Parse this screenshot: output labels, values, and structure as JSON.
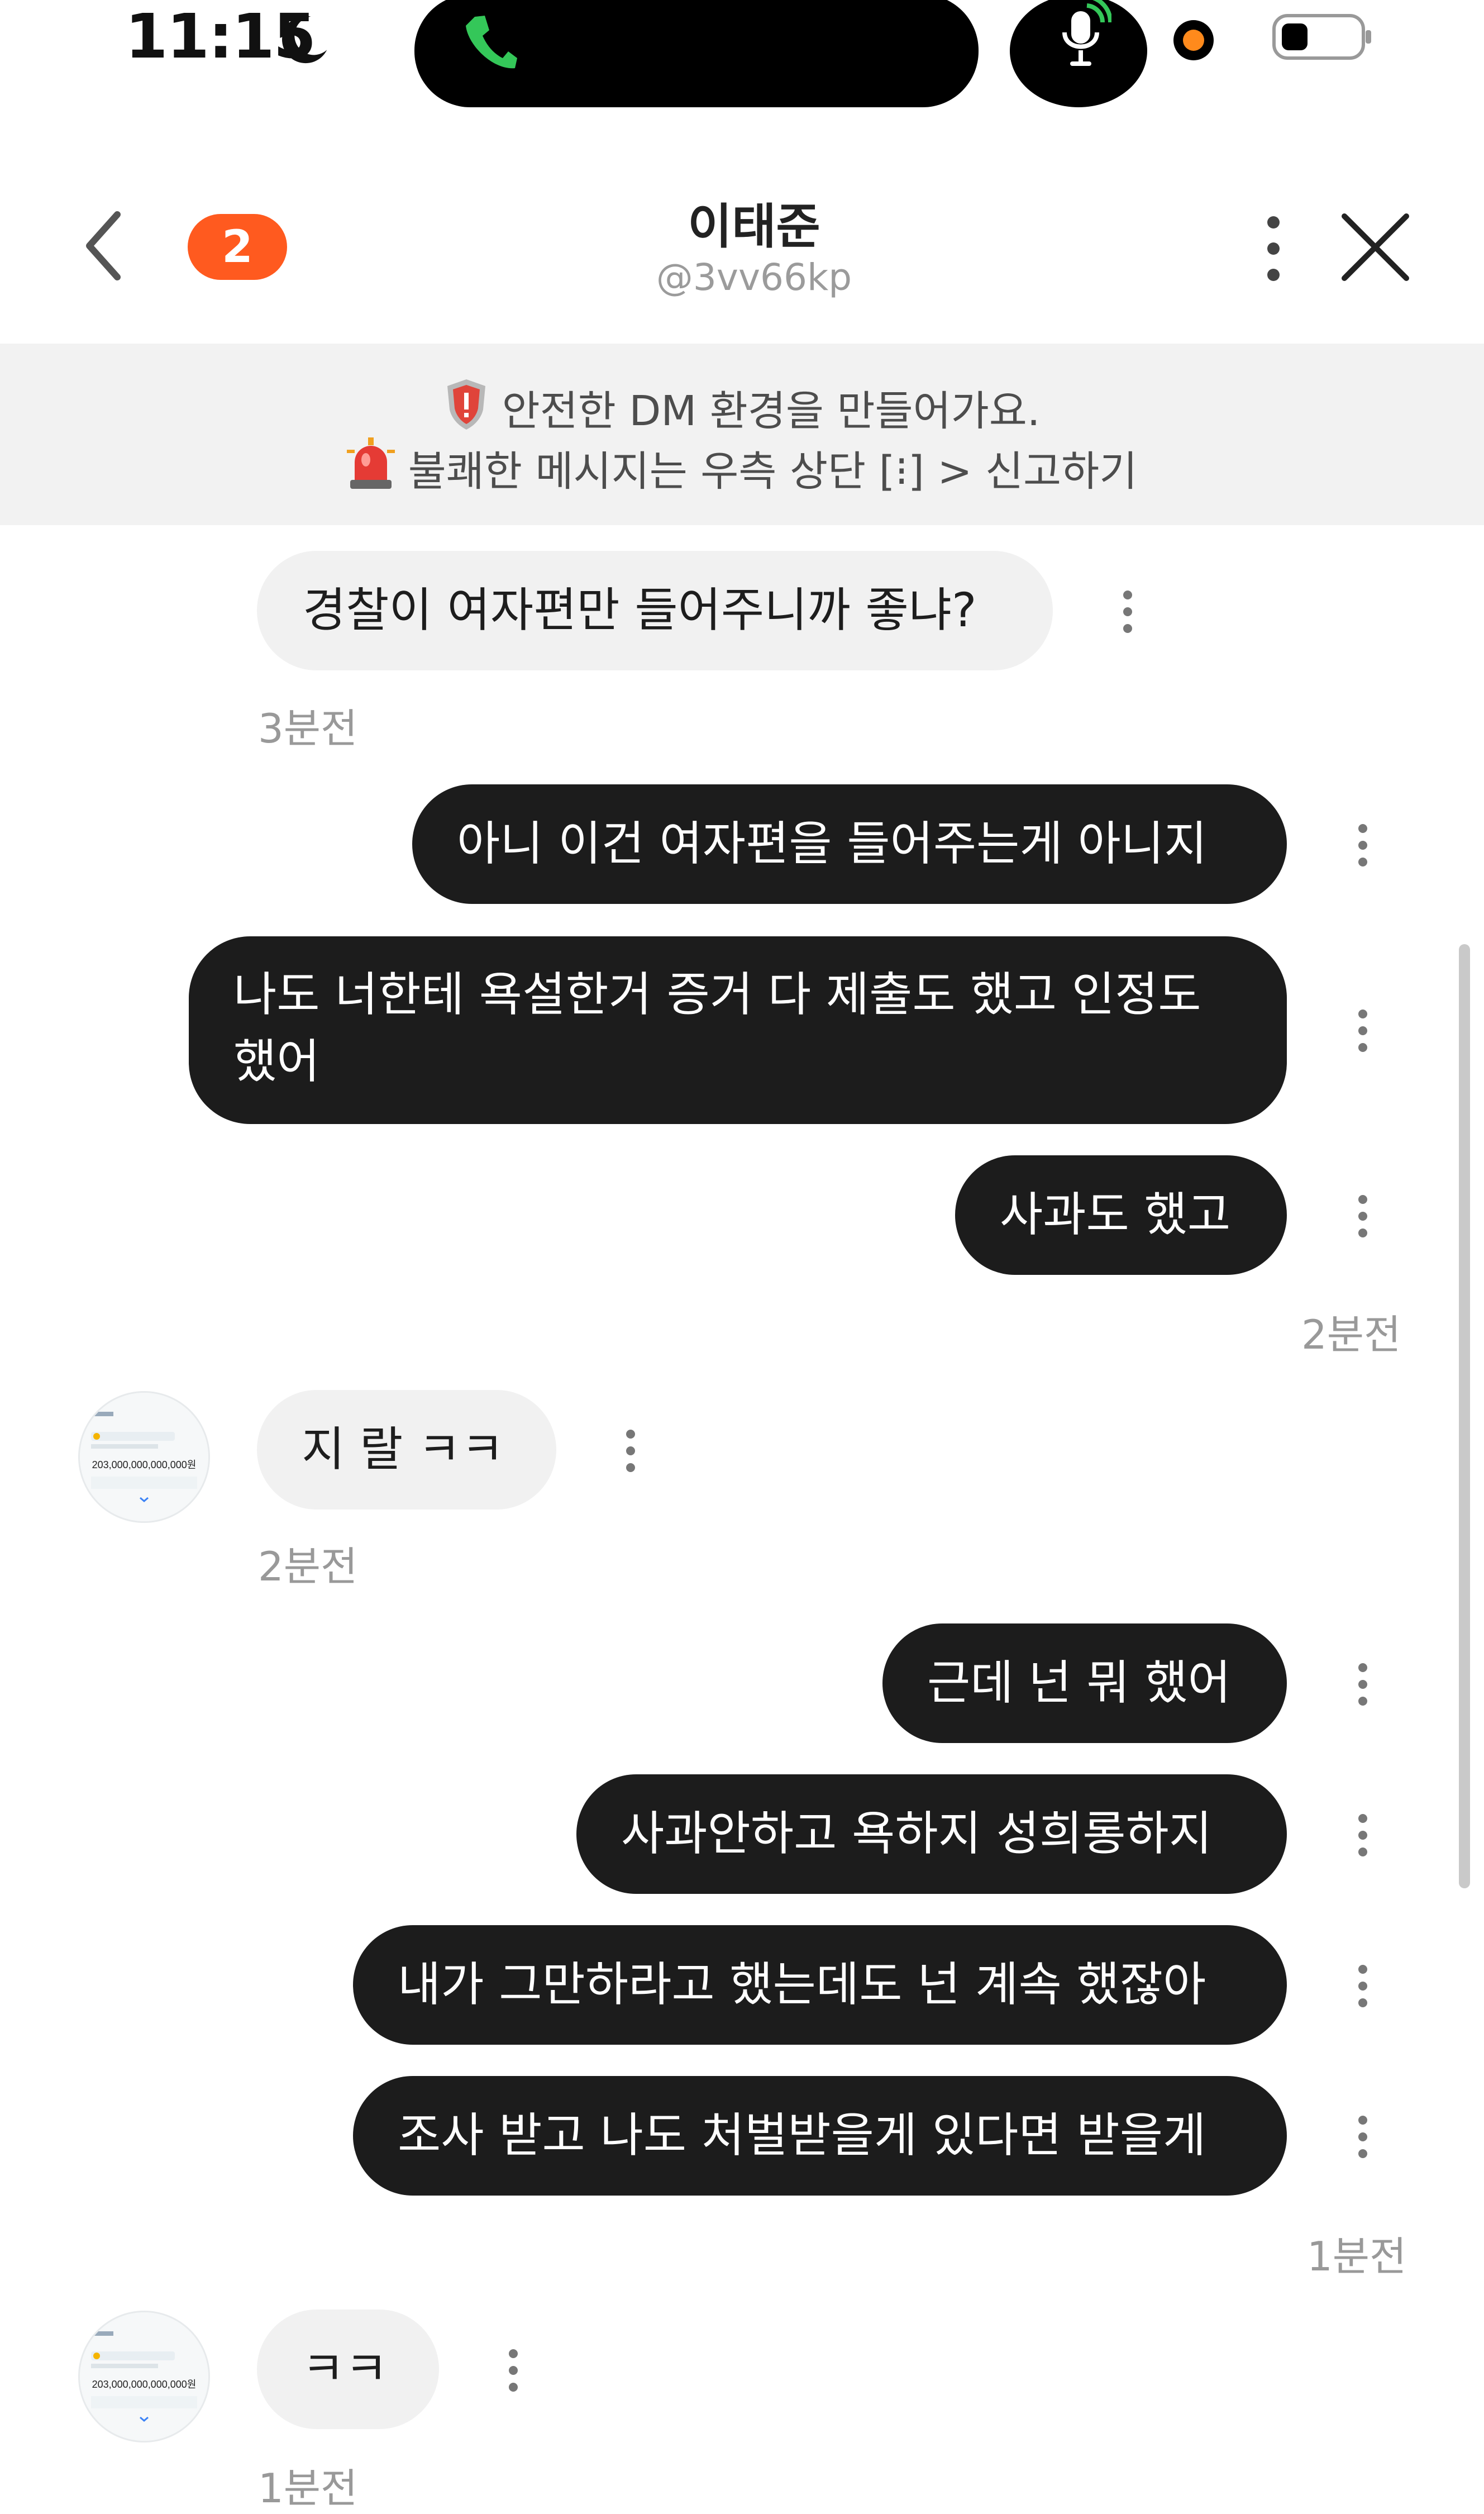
{
  "status_bar": {
    "time": "11:15",
    "icons": [
      "moon-icon",
      "phone-call-icon",
      "microphone-icon",
      "recording-dot-icon",
      "battery-icon"
    ],
    "colors": {
      "call_green": "#34c759",
      "recording_orange": "#ff8a1c"
    }
  },
  "header": {
    "unread_count": "2",
    "name": "이태준",
    "handle": "@3vv66kp",
    "icons": [
      "back-chevron-icon",
      "more-vertical-icon",
      "close-icon"
    ],
    "colors": {
      "badge": "#ff5a1f"
    }
  },
  "notice": {
    "line1": "안전한 DM 환경을 만들어가요.",
    "line2": "불쾌한 메시지는 우측 상단 [⁝] > 신고하기",
    "icons": [
      "shield-icon",
      "siren-icon"
    ]
  },
  "messages": [
    {
      "text": "경찰이 여자편만 들어주니까 좋냐?"
    },
    {
      "time": "3분전"
    },
    {
      "text": "아니 이건 여자편을 들어주는게 아니지"
    },
    {
      "line1": "나도 너한테 욕설한거 증거 다 제출도 했고 인정도",
      "line2": "했어"
    },
    {
      "text": "사과도 했고"
    },
    {
      "time": "2분전"
    },
    {
      "text": "지 랄 ㅋㅋ"
    },
    {
      "time": "2분전"
    },
    {
      "text": "근데 넌 뭐 했어"
    },
    {
      "text": "사과안하고 욕하지 성희롱하지"
    },
    {
      "text": "내가 그만하라고 했는데도 넌 계속 했잖아"
    },
    {
      "text": "조사 받고 나도 처벌받을게 있다면 받을게"
    },
    {
      "time": "1분전"
    },
    {
      "text": "ㅋㅋ"
    },
    {
      "time": "1분전"
    }
  ],
  "avatar": {
    "amount": "203,000,000,000,000원",
    "icon": "bank-app-screenshot-avatar"
  },
  "colors": {
    "incoming_bubble": "#f1f1f1",
    "outgoing_bubble": "#1c1c1c"
  }
}
